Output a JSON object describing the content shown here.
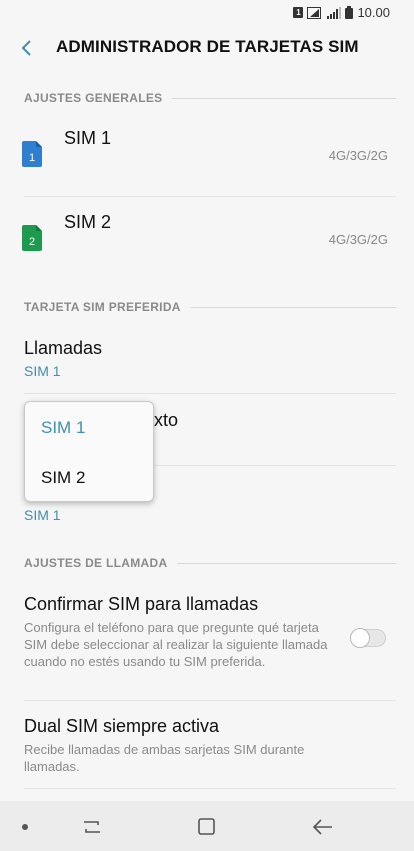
{
  "status_bar": {
    "sim_badge": "1",
    "time": "10.00"
  },
  "header": {
    "title": "ADMINISTRADOR DE TARJETAS SIM"
  },
  "sections": {
    "general": "AJUSTES GENERALES",
    "preferred": "TARJETA SIM PREFERIDA",
    "call": "AJUSTES DE LLAMADA"
  },
  "sims": [
    {
      "name": "SIM 1",
      "network": "4G/3G/2G",
      "number": "1",
      "color": "#2f7fd0"
    },
    {
      "name": "SIM 2",
      "network": "4G/3G/2G",
      "number": "2",
      "color": "#1e9a4f"
    }
  ],
  "preferred": {
    "calls": {
      "label": "Llamadas",
      "value": "SIM 1"
    },
    "text_partial": "xto",
    "third_value": "SIM 1"
  },
  "popup": {
    "options": [
      "SIM 1",
      "SIM 2"
    ],
    "selected": "SIM 1"
  },
  "call_settings": {
    "confirm": {
      "title": "Confirmar SIM para llamadas",
      "description": "Configura el teléfono para que pregunte qué tarjeta SIM debe seleccionar al realizar la siguiente llamada cuando no estés usando tu SIM preferida.",
      "enabled": false
    },
    "dual": {
      "title": "Dual SIM siempre activa",
      "description": "Recibe llamadas de ambas sarjetas SIM durante llamadas."
    }
  },
  "colors": {
    "accent": "#3e8fb0"
  }
}
